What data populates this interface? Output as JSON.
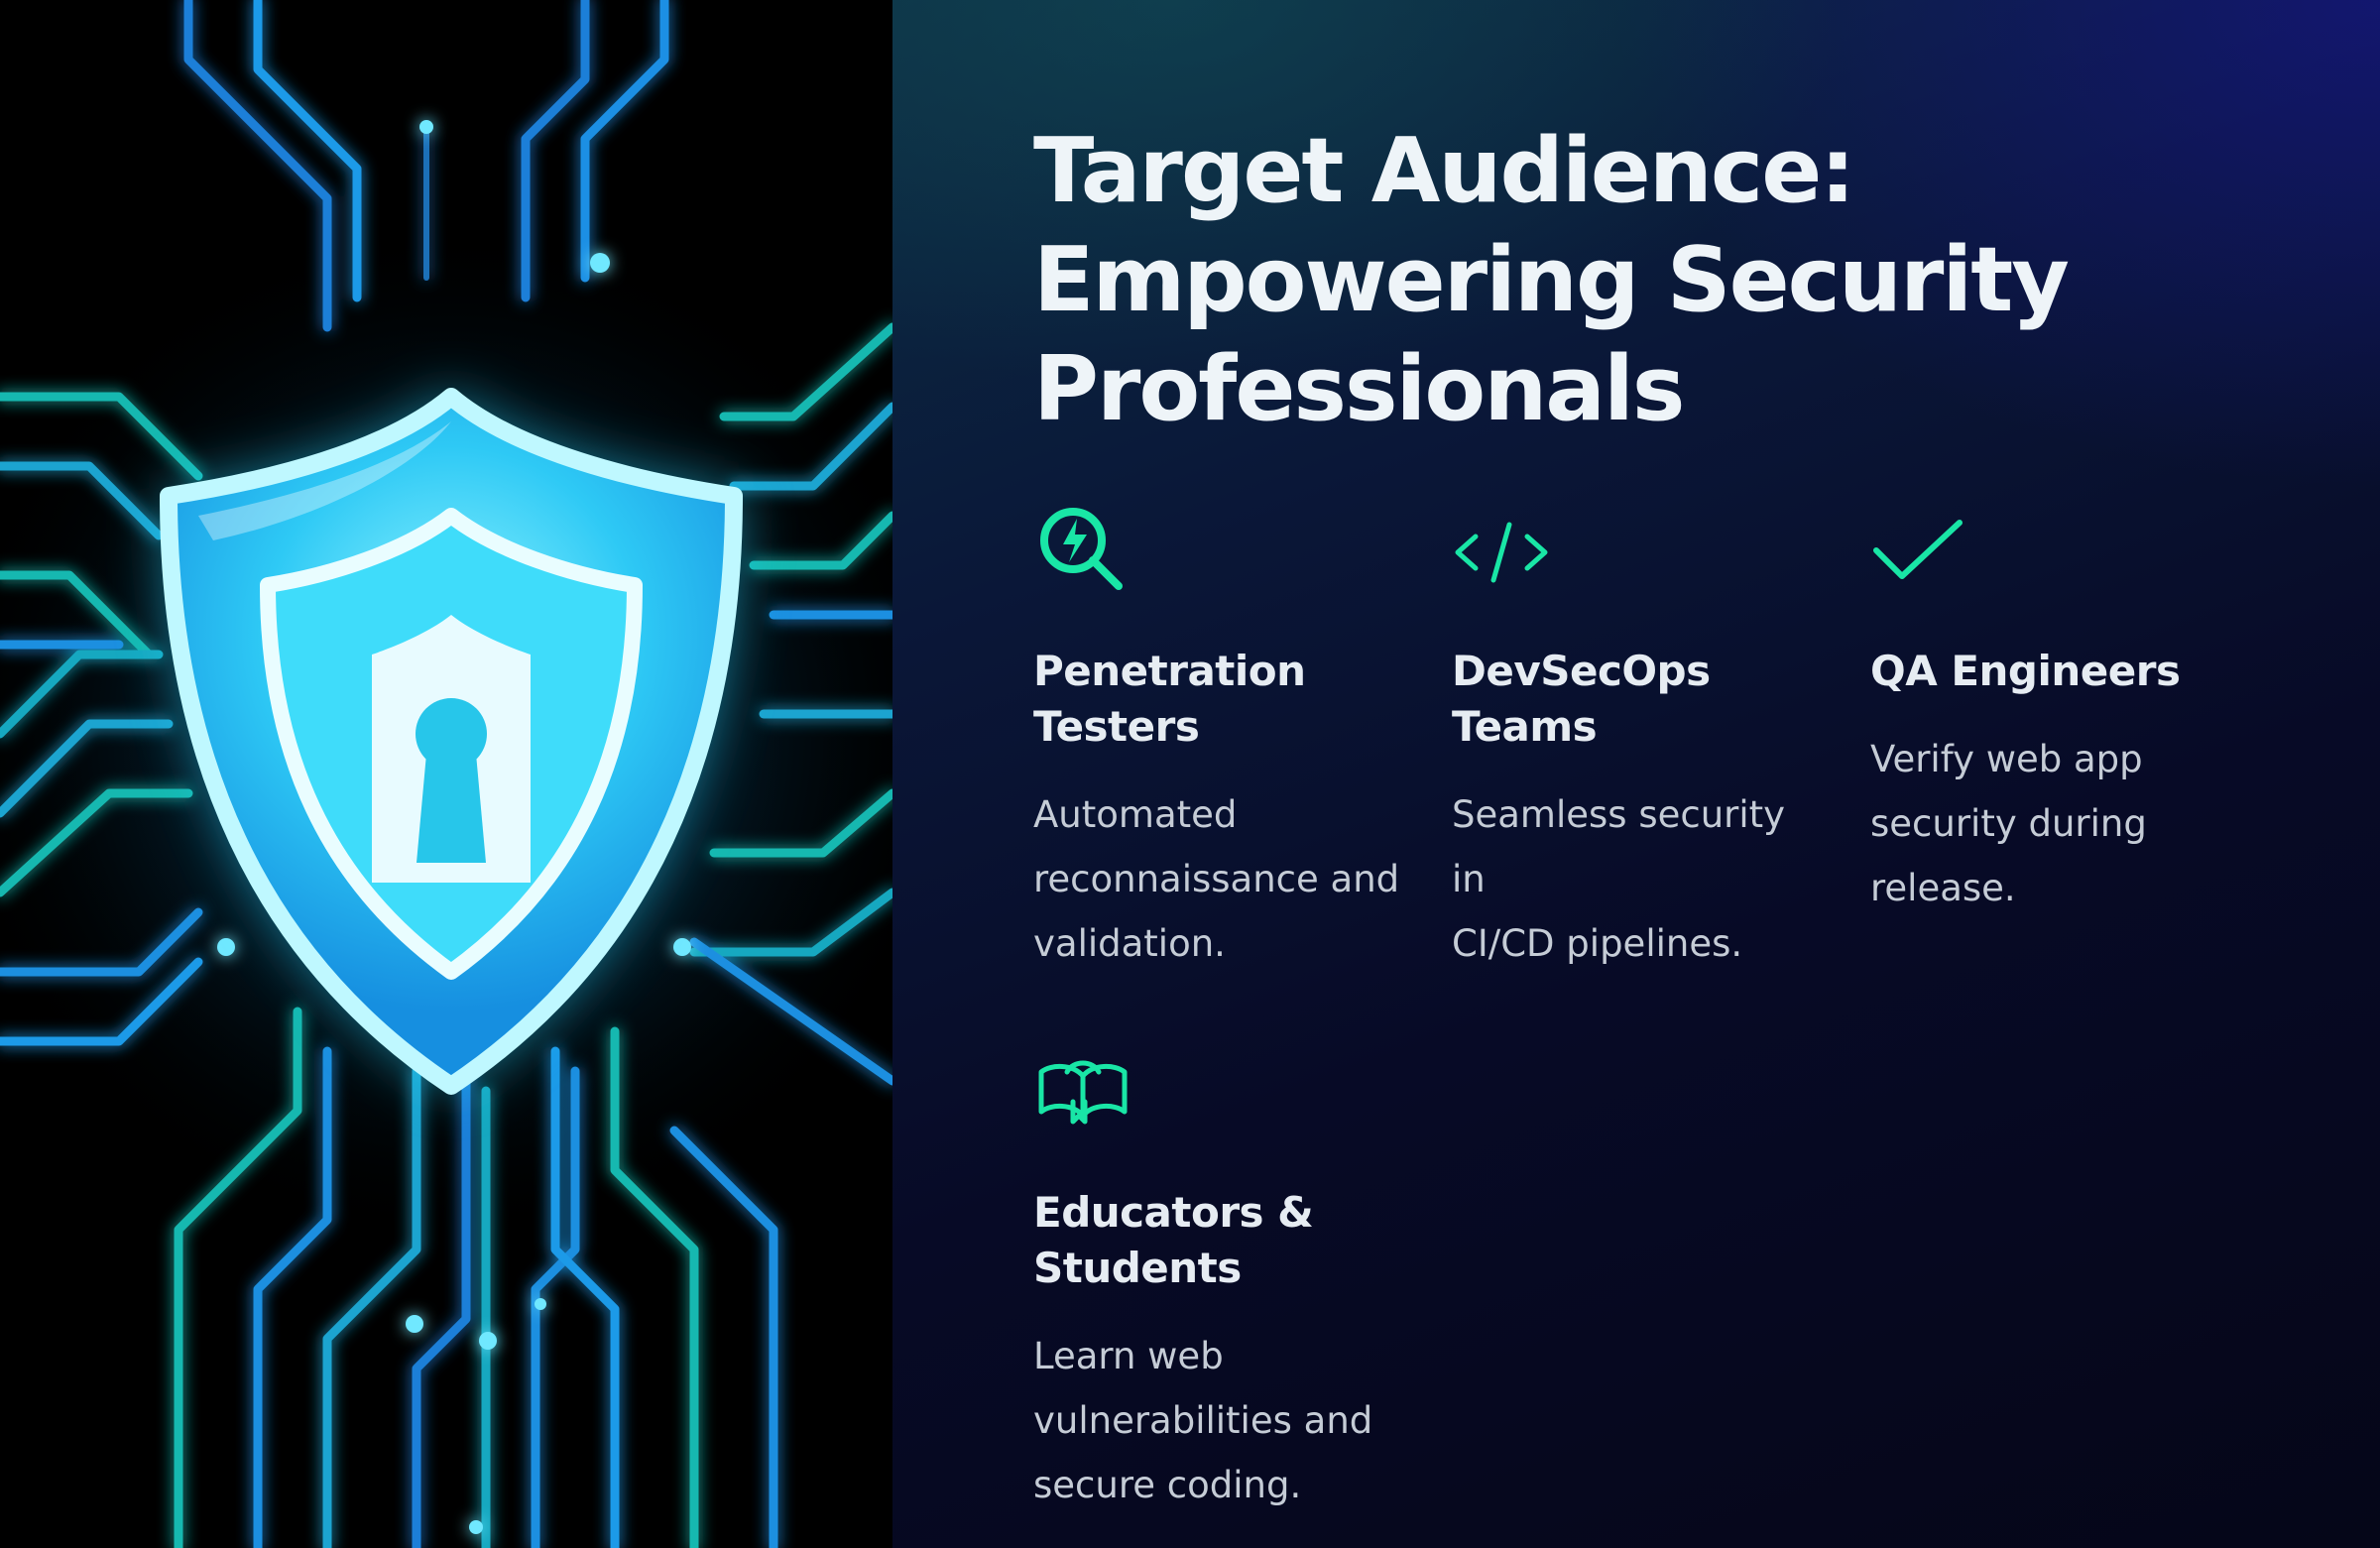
{
  "title_lines": [
    "Target Audience:",
    "Empowering Security",
    "Professionals"
  ],
  "accent_color": "#19e6a6",
  "image": {
    "description_icon": "glowing-shield-keyhole-circuit-illustration"
  },
  "cards": [
    {
      "icon": "magnifier-lightning-icon",
      "title_lines": [
        "Penetration",
        "Testers"
      ],
      "desc_lines": [
        "Automated",
        "reconnaissance and",
        "validation."
      ]
    },
    {
      "icon": "code-brackets-icon",
      "title_lines": [
        "DevSecOps",
        "Teams"
      ],
      "desc_lines": [
        "Seamless security in",
        "CI/CD pipelines."
      ]
    },
    {
      "icon": "checkmark-icon",
      "title_lines": [
        "QA Engineers"
      ],
      "desc_lines": [
        "Verify web app",
        "security during",
        "release."
      ]
    },
    {
      "icon": "open-book-icon",
      "title_lines": [
        "Educators &",
        "Students"
      ],
      "desc_lines": [
        "Learn web",
        "vulnerabilities and",
        "secure coding."
      ]
    }
  ]
}
